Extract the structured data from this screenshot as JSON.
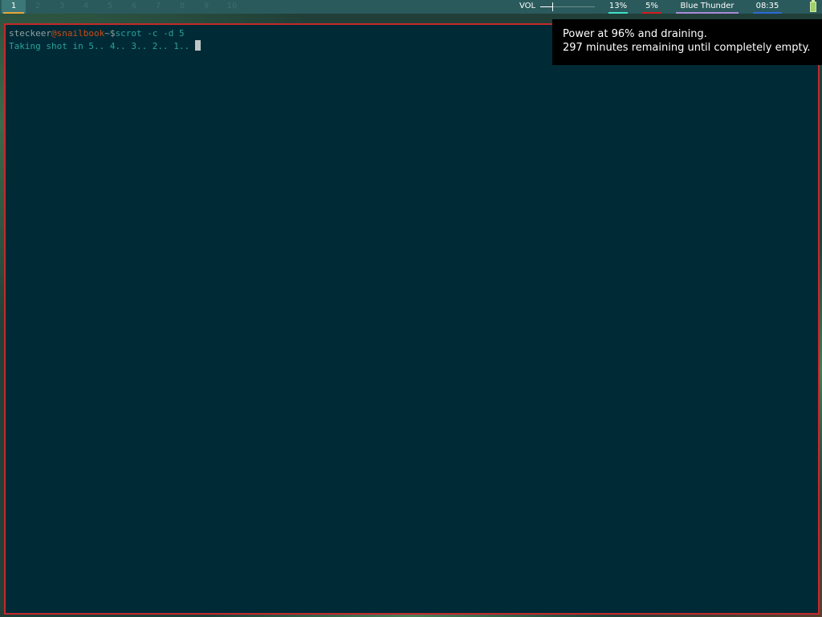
{
  "workspaces": [
    {
      "label": "1",
      "active": true
    },
    {
      "label": "2",
      "active": false
    },
    {
      "label": "3",
      "active": false
    },
    {
      "label": "4",
      "active": false
    },
    {
      "label": "5",
      "active": false
    },
    {
      "label": "6",
      "active": false
    },
    {
      "label": "7",
      "active": false
    },
    {
      "label": "8",
      "active": false
    },
    {
      "label": "9",
      "active": false
    },
    {
      "label": "10",
      "active": false
    }
  ],
  "statusbar": {
    "vol_label": "VOL",
    "vol_level": 0.22,
    "cpu": "13%",
    "mem": "5%",
    "network": "Blue Thunder",
    "clock": "08:35",
    "battery_icon": "battery-icon",
    "colors": {
      "workspace_underline": "#e8a53a",
      "cpu_underline": "#3de0c8",
      "mem_underline": "#d01e1e",
      "network_underline": "#a98ad8",
      "clock_underline": "#2a6ad8"
    }
  },
  "terminal": {
    "prompt_user": "steckeer",
    "prompt_at": "@",
    "prompt_host": "snailbook",
    "prompt_cwd": "~$",
    "command": "scrot -c -d 5",
    "output": "Taking shot in 5.. 4.. 3.. 2.. 1.. "
  },
  "notification": {
    "line1": "Power at 96% and draining.",
    "line2": "297 minutes remaining until completely empty."
  }
}
